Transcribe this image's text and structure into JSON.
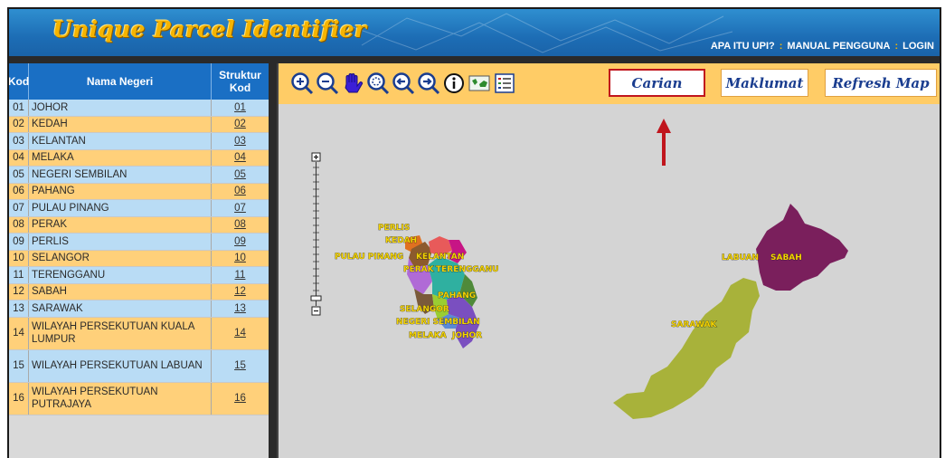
{
  "header": {
    "title": "Unique Parcel Identifier",
    "links": [
      "APA ITU UPI?",
      "MANUAL PENGGUNA",
      "LOGIN"
    ]
  },
  "table": {
    "headers": {
      "kod": "Kod",
      "nama": "Nama Negeri",
      "struktur": "Struktur Kod"
    },
    "rows": [
      {
        "kod": "01",
        "nama": "JOHOR",
        "struktur": "01"
      },
      {
        "kod": "02",
        "nama": "KEDAH",
        "struktur": "02"
      },
      {
        "kod": "03",
        "nama": "KELANTAN",
        "struktur": "03"
      },
      {
        "kod": "04",
        "nama": "MELAKA",
        "struktur": "04"
      },
      {
        "kod": "05",
        "nama": "NEGERI SEMBILAN",
        "struktur": "05"
      },
      {
        "kod": "06",
        "nama": "PAHANG",
        "struktur": "06"
      },
      {
        "kod": "07",
        "nama": "PULAU PINANG",
        "struktur": "07"
      },
      {
        "kod": "08",
        "nama": "PERAK",
        "struktur": "08"
      },
      {
        "kod": "09",
        "nama": "PERLIS",
        "struktur": "09"
      },
      {
        "kod": "10",
        "nama": "SELANGOR",
        "struktur": "10"
      },
      {
        "kod": "11",
        "nama": "TERENGGANU",
        "struktur": "11"
      },
      {
        "kod": "12",
        "nama": "SABAH",
        "struktur": "12"
      },
      {
        "kod": "13",
        "nama": "SARAWAK",
        "struktur": "13"
      },
      {
        "kod": "14",
        "nama": "WILAYAH PERSEKUTUAN KUALA LUMPUR",
        "struktur": "14"
      },
      {
        "kod": "15",
        "nama": "WILAYAH PERSEKUTUAN LABUAN",
        "struktur": "15"
      },
      {
        "kod": "16",
        "nama": "WILAYAH PERSEKUTUAN PUTRAJAYA",
        "struktur": "16"
      }
    ]
  },
  "toolbar": {
    "tools": [
      "zoom-in-icon",
      "zoom-out-icon",
      "pan-hand-icon",
      "zoom-extent-icon",
      "previous-extent-icon",
      "next-extent-icon",
      "info-icon",
      "map-overview-icon",
      "legend-list-icon"
    ],
    "tabs": [
      "Carian",
      "Maklumat",
      "Refresh Map"
    ],
    "active_tab": "Carian"
  },
  "map": {
    "labels": [
      "PERLIS",
      "KEDAH",
      "PULAU PINANG",
      "KELANTAN",
      "PERAK",
      "TERENGGANU",
      "PAHANG",
      "SELANGOR",
      "NEGERI SEMBILAN",
      "MELAKA",
      "JOHOR",
      "LABUAN",
      "SABAH",
      "SARAWAK"
    ]
  },
  "colors": {
    "header": "#1d6db5",
    "title": "#f5b400",
    "row_blue": "#b9dcf5",
    "row_orange": "#ffd07a",
    "toolbar": "#ffcc66",
    "highlight": "#c0151d"
  }
}
